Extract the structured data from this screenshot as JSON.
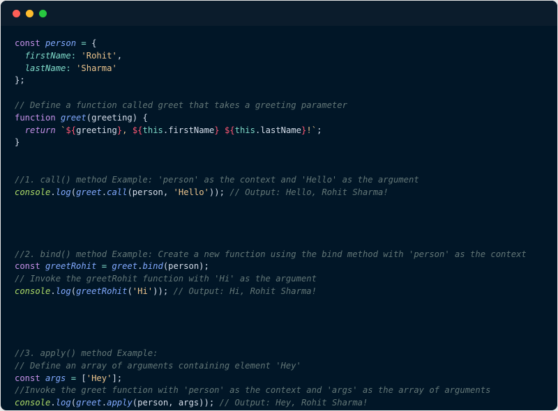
{
  "window": {
    "controls": [
      "close",
      "minimize",
      "maximize"
    ],
    "colors": {
      "close": "#ff5f57",
      "minimize": "#febc2e",
      "maximize": "#28c840",
      "background": "#011627"
    }
  },
  "code": {
    "lines": [
      [
        [
          "kw",
          "const "
        ],
        [
          "vi",
          "person"
        ],
        [
          "op",
          " = "
        ],
        [
          "pl",
          "{"
        ]
      ],
      [
        [
          "pl",
          "  "
        ],
        [
          "pr",
          "firstName"
        ],
        [
          "op",
          ": "
        ],
        [
          "st",
          "'Rohit'"
        ],
        [
          "pl",
          ","
        ]
      ],
      [
        [
          "pl",
          "  "
        ],
        [
          "pr",
          "lastName"
        ],
        [
          "op",
          ": "
        ],
        [
          "st",
          "'Sharma'"
        ]
      ],
      [
        [
          "pl",
          "};"
        ]
      ],
      [],
      [
        [
          "cm",
          "// Define a function called greet that takes a greeting parameter"
        ]
      ],
      [
        [
          "kw",
          "function "
        ],
        [
          "vi",
          "greet"
        ],
        [
          "pl",
          "(greeting) {"
        ]
      ],
      [
        [
          "pl",
          "  "
        ],
        [
          "rt",
          "return "
        ],
        [
          "st",
          "`"
        ],
        [
          "tp",
          "${"
        ],
        [
          "pl",
          "greeting"
        ],
        [
          "tp",
          "}"
        ],
        [
          "st",
          ", "
        ],
        [
          "tp",
          "${"
        ],
        [
          "th",
          "this"
        ],
        [
          "pl",
          ".firstName"
        ],
        [
          "tp",
          "}"
        ],
        [
          "st",
          " "
        ],
        [
          "tp",
          "${"
        ],
        [
          "th",
          "this"
        ],
        [
          "pl",
          ".lastName"
        ],
        [
          "tp",
          "}"
        ],
        [
          "st",
          "!`"
        ],
        [
          "pl",
          ";"
        ]
      ],
      [
        [
          "pl",
          "}"
        ]
      ],
      [],
      [],
      [
        [
          "cm",
          "//1. call() method Example: 'person' as the context and 'Hello' as the argument"
        ]
      ],
      [
        [
          "cl",
          "console"
        ],
        [
          "pl",
          "."
        ],
        [
          "vi",
          "log"
        ],
        [
          "pl",
          "("
        ],
        [
          "vi",
          "greet"
        ],
        [
          "pl",
          "."
        ],
        [
          "vi",
          "call"
        ],
        [
          "pl",
          "(person, "
        ],
        [
          "st",
          "'Hello'"
        ],
        [
          "pl",
          "));"
        ],
        [
          "cm",
          " // Output: Hello, Rohit Sharma!"
        ]
      ],
      [],
      [],
      [],
      [],
      [
        [
          "cm",
          "//2. bind() method Example: Create a new function using the bind method with 'person' as the context"
        ]
      ],
      [
        [
          "kw",
          "const "
        ],
        [
          "vi",
          "greetRohit"
        ],
        [
          "op",
          " = "
        ],
        [
          "vi",
          "greet"
        ],
        [
          "pl",
          "."
        ],
        [
          "vi",
          "bind"
        ],
        [
          "pl",
          "(person);"
        ]
      ],
      [
        [
          "cm",
          "// Invoke the greetRohit function with 'Hi' as the argument"
        ]
      ],
      [
        [
          "cl",
          "console"
        ],
        [
          "pl",
          "."
        ],
        [
          "vi",
          "log"
        ],
        [
          "pl",
          "("
        ],
        [
          "vi",
          "greetRohit"
        ],
        [
          "pl",
          "("
        ],
        [
          "st",
          "'Hi'"
        ],
        [
          "pl",
          "));"
        ],
        [
          "cm",
          " // Output: Hi, Rohit Sharma!"
        ]
      ],
      [],
      [],
      [],
      [],
      [
        [
          "cm",
          "//3. apply() method Example:"
        ]
      ],
      [
        [
          "cm",
          "// Define an array of arguments containing element 'Hey'"
        ]
      ],
      [
        [
          "kw",
          "const "
        ],
        [
          "vi",
          "args"
        ],
        [
          "op",
          " = "
        ],
        [
          "pl",
          "["
        ],
        [
          "st",
          "'Hey'"
        ],
        [
          "pl",
          "];"
        ]
      ],
      [
        [
          "cm",
          "//Invoke the greet function with 'person' as the context and 'args' as the array of arguments"
        ]
      ],
      [
        [
          "cl",
          "console"
        ],
        [
          "pl",
          "."
        ],
        [
          "vi",
          "log"
        ],
        [
          "pl",
          "("
        ],
        [
          "vi",
          "greet"
        ],
        [
          "pl",
          "."
        ],
        [
          "vi",
          "apply"
        ],
        [
          "pl",
          "(person, args));"
        ],
        [
          "cm",
          " // Output: Hey, Rohit Sharma!"
        ]
      ]
    ]
  }
}
